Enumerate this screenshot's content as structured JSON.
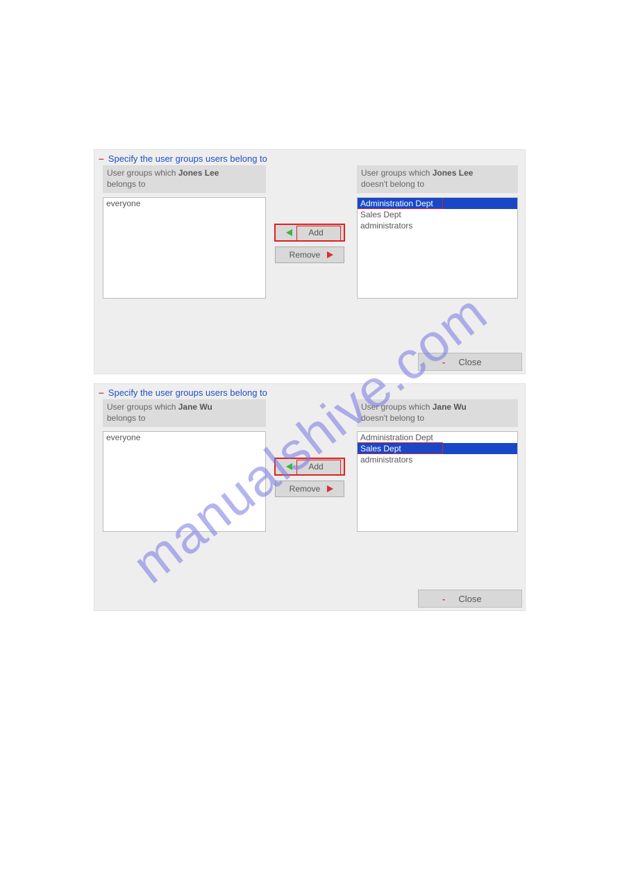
{
  "watermark": "manualshive.com",
  "panels": [
    {
      "title": "Specify the user groups users belong to",
      "user": "Jones Lee",
      "label_prefix": "User groups which ",
      "label_suffix_left": "belongs to",
      "label_suffix_right": "doesn't belong to",
      "belongs": [
        "everyone"
      ],
      "not_belongs": [
        {
          "text": "Administration Dept",
          "selected": true,
          "highlight_box": true
        },
        {
          "text": "Sales Dept",
          "selected": false,
          "highlight_box": false
        },
        {
          "text": "administrators",
          "selected": false,
          "highlight_box": false
        }
      ],
      "add_label": "Add",
      "remove_label": "Remove",
      "close_label": "Close"
    },
    {
      "title": "Specify the user groups users belong to",
      "user": "Jane Wu",
      "label_prefix": "User groups which ",
      "label_suffix_left": "belongs to",
      "label_suffix_right": "doesn't belong to",
      "belongs": [
        "everyone"
      ],
      "not_belongs": [
        {
          "text": "Administration Dept",
          "selected": false,
          "highlight_box": false
        },
        {
          "text": "Sales Dept",
          "selected": true,
          "highlight_box": true
        },
        {
          "text": "administrators",
          "selected": false,
          "highlight_box": false
        }
      ],
      "add_label": "Add",
      "remove_label": "Remove",
      "close_label": "Close"
    }
  ]
}
